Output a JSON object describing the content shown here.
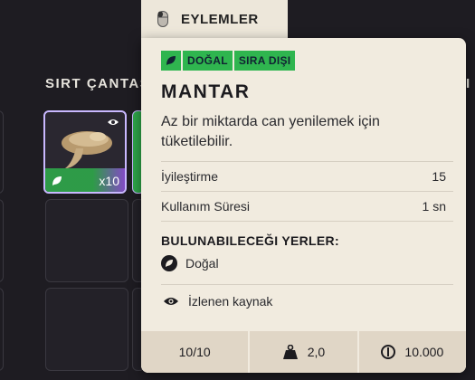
{
  "tab": {
    "label": "EYLEMLER",
    "icon": "mouse-icon"
  },
  "inventory": {
    "title": "SIRT ÇANTASI",
    "right_label": "I",
    "selected_slot": {
      "quantity": "x10",
      "icon": "mushroom-icon",
      "badge": "leaf-icon",
      "tracked_icon": "eye-icon"
    }
  },
  "tooltip": {
    "tags": [
      "DOĞAL",
      "SIRA DIŞI"
    ],
    "name": "MANTAR",
    "description": "Az bir miktarda can yenilemek için tüketilebilir.",
    "stats": [
      {
        "label": "İyileştirme",
        "value": "15"
      },
      {
        "label": "Kullanım Süresi",
        "value": "1 sn"
      }
    ],
    "sources_title": "BULUNABILECEĞI YERLER:",
    "sources": [
      {
        "label": "Doğal",
        "icon": "leaf-circle-icon"
      }
    ],
    "tracked_label": "İzlenen kaynak",
    "footer": {
      "stack": "10/10",
      "weight": "2,0",
      "price": "10.000"
    }
  },
  "colors": {
    "tag_green": "#2fb54f",
    "panel_bg": "#f1ebdf",
    "footer_bg": "#e0d6c6",
    "background": "#1e1c22",
    "slot_border_selected": "#c9b8ff"
  }
}
